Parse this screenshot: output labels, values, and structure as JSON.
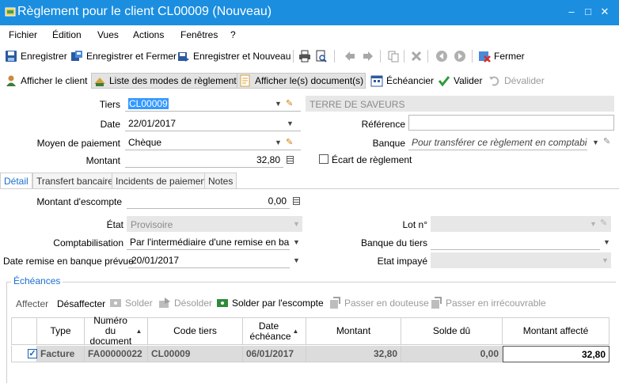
{
  "window": {
    "title": "Règlement pour le client CL00009 (Nouveau)",
    "minimize": "–",
    "maximize": "□",
    "close": "✕"
  },
  "menu": [
    "Fichier",
    "Édition",
    "Vues",
    "Actions",
    "Fenêtres",
    "?"
  ],
  "toolbar1": {
    "save": "Enregistrer",
    "save_close": "Enregistrer et Fermer",
    "save_new": "Enregistrer et Nouveau",
    "close": "Fermer"
  },
  "toolbar2": {
    "show_client": "Afficher le client",
    "payment_modes": "Liste des modes de règlement",
    "show_documents": "Afficher le(s) document(s)",
    "schedule": "Échéancier",
    "validate": "Valider",
    "invalidate": "Dévalider"
  },
  "form": {
    "tiers_label": "Tiers",
    "tiers_value": "CL00009",
    "tiers_name": "TERRE DE SAVEURS",
    "date_label": "Date",
    "date_value": "22/01/2017",
    "reference_label": "Référence",
    "reference_value": "",
    "payment_method_label": "Moyen de paiement",
    "payment_method_value": "Chèque",
    "bank_label": "Banque",
    "bank_placeholder": "Pour transférer ce règlement en comptabilité,",
    "amount_label": "Montant",
    "amount_value": "32,80",
    "gap_label": "Écart de règlement"
  },
  "tabs": [
    "Détail",
    "Transfert bancaire",
    "Incidents de paiement",
    "Notes"
  ],
  "detail": {
    "discount_label": "Montant d'escompte",
    "discount_value": "0,00",
    "state_label": "État",
    "state_value": "Provisoire",
    "lot_label": "Lot n°",
    "lot_value": "",
    "accounting_label": "Comptabilisation",
    "accounting_value": "Par l'intermédiaire d'une remise en ban...",
    "third_bank_label": "Banque du tiers",
    "third_bank_value": "",
    "deposit_date_label": "Date remise en banque prévue",
    "deposit_date_value": "20/01/2017",
    "unpaid_state_label": "Etat impayé",
    "unpaid_state_value": ""
  },
  "echeances": {
    "title": "Échéances",
    "actions": {
      "assign": "Affecter",
      "unassign": "Désaffecter",
      "settle": "Solder",
      "unsettle": "Désolder",
      "settle_discount": "Solder par l'escompte",
      "doubtful": "Passer en douteuse",
      "irrecoverable": "Passer en irrécouvrable"
    },
    "columns": [
      "Type",
      "Numéro du document",
      "Code tiers",
      "Date échéance",
      "Montant",
      "Solde dû",
      "Montant affecté"
    ],
    "rows": [
      {
        "type": "Facture",
        "document": "FA00000022",
        "code": "CL00009",
        "due_date": "06/01/2017",
        "amount": "32,80",
        "balance": "0,00",
        "assigned": "32,80"
      }
    ]
  }
}
